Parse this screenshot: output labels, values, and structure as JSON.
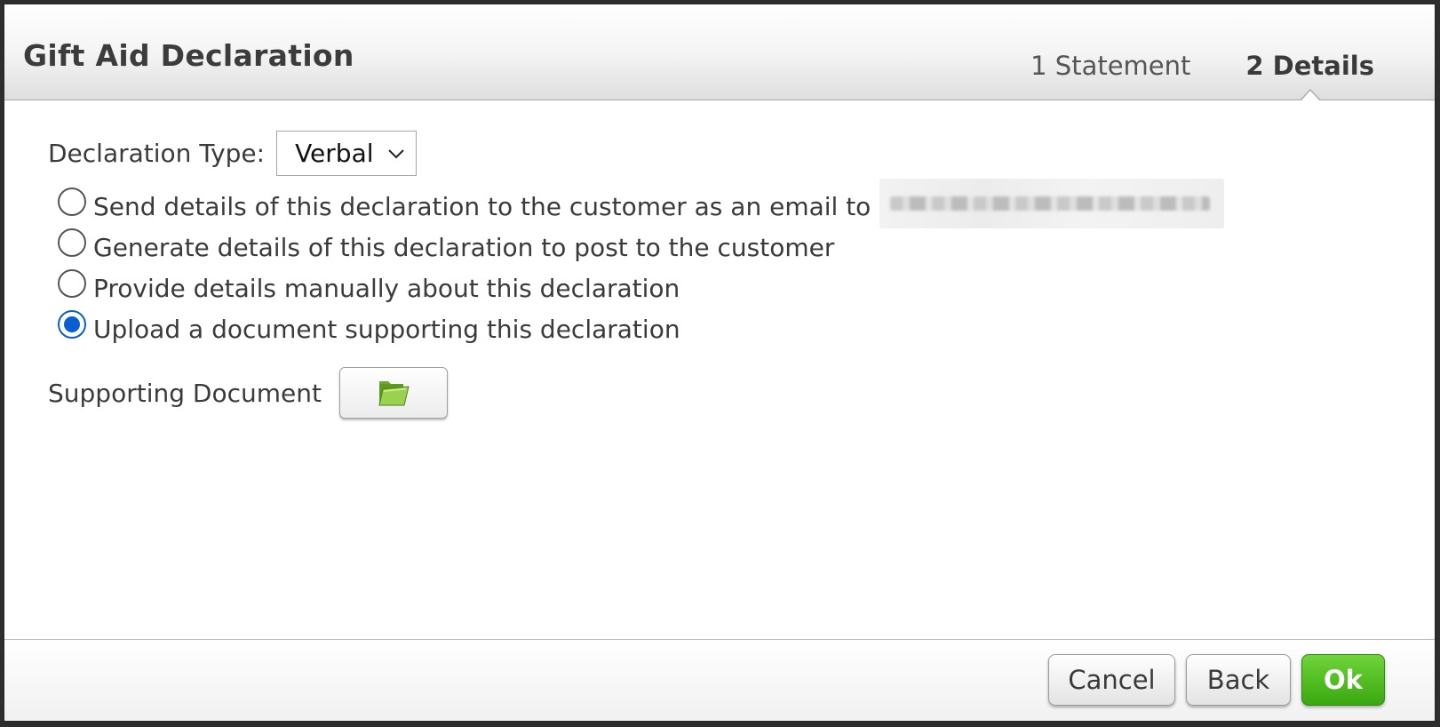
{
  "dialog": {
    "title": "Gift Aid Declaration",
    "steps": [
      {
        "label": "1 Statement",
        "active": false
      },
      {
        "label": "2 Details",
        "active": true
      }
    ]
  },
  "declaration_type": {
    "label": "Declaration Type:",
    "selected": "Verbal"
  },
  "options": [
    {
      "label": "Send details of this declaration to the customer as an email to",
      "checked": false
    },
    {
      "label": "Generate details of this declaration to post to the customer",
      "checked": false
    },
    {
      "label": "Provide details manually about this declaration",
      "checked": false
    },
    {
      "label": "Upload a document supporting this declaration",
      "checked": true
    }
  ],
  "supporting_document": {
    "label": "Supporting Document",
    "button_icon": "folder-icon"
  },
  "footer": {
    "cancel_label": "Cancel",
    "back_label": "Back",
    "ok_label": "Ok"
  },
  "colors": {
    "radio_checked": "#0a5fd0",
    "ok_button": "#4cbb1c",
    "folder": "#7fbf3a"
  }
}
